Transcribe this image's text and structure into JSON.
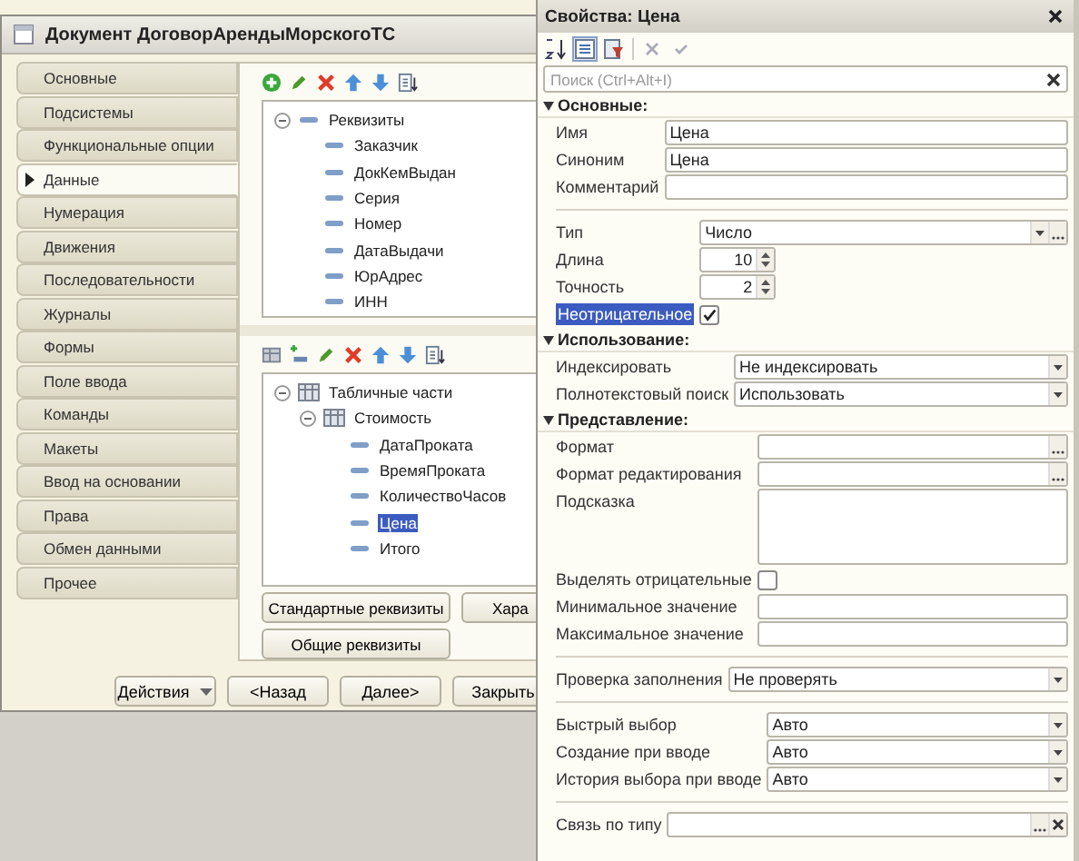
{
  "window": {
    "title": "Документ ДоговорАрендыМорскогоТС"
  },
  "nav": [
    {
      "label": "Основные",
      "selected": false
    },
    {
      "label": "Подсистемы",
      "selected": false
    },
    {
      "label": "Функциональные опции",
      "selected": false
    },
    {
      "label": "Данные",
      "selected": true
    },
    {
      "label": "Нумерация",
      "selected": false
    },
    {
      "label": "Движения",
      "selected": false
    },
    {
      "label": "Последовательности",
      "selected": false
    },
    {
      "label": "Журналы",
      "selected": false
    },
    {
      "label": "Формы",
      "selected": false
    },
    {
      "label": "Поле ввода",
      "selected": false
    },
    {
      "label": "Команды",
      "selected": false
    },
    {
      "label": "Макеты",
      "selected": false
    },
    {
      "label": "Ввод на основании",
      "selected": false
    },
    {
      "label": "Права",
      "selected": false
    },
    {
      "label": "Обмен данными",
      "selected": false
    },
    {
      "label": "Прочее",
      "selected": false
    }
  ],
  "attributes_tree": [
    {
      "label": "Реквизиты",
      "kind": "group",
      "expanded": true,
      "selected": false,
      "children": [
        {
          "label": "Заказчик",
          "kind": "attribute",
          "selected": false
        },
        {
          "label": "ДокКемВыдан",
          "kind": "attribute",
          "selected": false
        },
        {
          "label": "Серия",
          "kind": "attribute",
          "selected": false
        },
        {
          "label": "Номер",
          "kind": "attribute",
          "selected": false
        },
        {
          "label": "ДатаВыдачи",
          "kind": "attribute",
          "selected": false
        },
        {
          "label": "ЮрАдрес",
          "kind": "attribute",
          "selected": false
        },
        {
          "label": "ИНН",
          "kind": "attribute",
          "selected": false
        }
      ]
    }
  ],
  "tables_tree": [
    {
      "label": "Табличные части",
      "kind": "table",
      "expanded": true,
      "selected": false,
      "children": [
        {
          "label": "Стоимость",
          "kind": "table",
          "expanded": true,
          "selected": false,
          "children": [
            {
              "label": "ДатаПроката",
              "kind": "attribute",
              "selected": false
            },
            {
              "label": "ВремяПроката",
              "kind": "attribute",
              "selected": false
            },
            {
              "label": "КоличествоЧасов",
              "kind": "attribute",
              "selected": false
            },
            {
              "label": "Цена",
              "kind": "attribute",
              "selected": true
            },
            {
              "label": "Итого",
              "kind": "attribute",
              "selected": false
            }
          ]
        }
      ]
    }
  ],
  "pane_buttons": [
    [
      "Стандартные реквизиты",
      "Хара"
    ],
    [
      "Общие реквизиты"
    ]
  ],
  "footer_buttons": [
    {
      "label": "Действия",
      "kind": "menu"
    },
    {
      "label": "<Назад",
      "kind": "plain"
    },
    {
      "label": "Далее>",
      "kind": "plain"
    },
    {
      "label": "Закрыть",
      "kind": "plain"
    }
  ],
  "properties": {
    "title": "Свойства: Цена",
    "search": {
      "placeholder": "Поиск (Ctrl+Alt+I)"
    },
    "sections": [
      {
        "title": "Основные:",
        "expanded": true,
        "blocks": [
          [
            {
              "kind": "text",
              "label": "Имя",
              "value": "Цена",
              "selected": false
            },
            {
              "kind": "text",
              "label": "Синоним",
              "value": "Цена",
              "selected": false
            },
            {
              "kind": "text",
              "label": "Комментарий",
              "selected": false
            }
          ],
          [
            {
              "kind": "select_choice",
              "label": "Тип",
              "value": "Число",
              "selected": false
            },
            {
              "kind": "spin",
              "label": "Длина",
              "value": "10",
              "selected": false
            },
            {
              "kind": "spin",
              "label": "Точность",
              "value": "2",
              "selected": false
            },
            {
              "kind": "checkbox",
              "label": "Неотрицательное",
              "checked": true,
              "selected": true
            }
          ]
        ]
      },
      {
        "title": "Использование:",
        "expanded": true,
        "blocks": [
          [
            {
              "kind": "select",
              "label": "Индексировать",
              "value": "Не индексировать",
              "selected": false
            },
            {
              "kind": "select",
              "label": "Полнотекстовый поиск",
              "value": "Использовать",
              "selected": false
            }
          ]
        ]
      },
      {
        "title": "Представление:",
        "expanded": true,
        "blocks": [
          [
            {
              "kind": "choice",
              "label": "Формат",
              "selected": false
            },
            {
              "kind": "choice",
              "label": "Формат редактирования",
              "selected": false
            },
            {
              "kind": "textarea",
              "label": "Подсказка",
              "selected": false
            },
            {
              "kind": "checkbox",
              "label": "Выделять отрицательные",
              "checked": false,
              "selected": false
            },
            {
              "kind": "text",
              "label": "Минимальное значение",
              "selected": false
            },
            {
              "kind": "text",
              "label": "Максимальное значение",
              "selected": false
            }
          ],
          [
            {
              "kind": "select",
              "label": "Проверка заполнения",
              "value": "Не проверять",
              "selected": false
            }
          ],
          [
            {
              "kind": "select",
              "label": "Быстрый выбор",
              "value": "Авто",
              "selected": false
            },
            {
              "kind": "select",
              "label": "Создание при вводе",
              "value": "Авто",
              "selected": false
            },
            {
              "kind": "select",
              "label": "История выбора при вводе",
              "value": "Авто",
              "selected": false
            }
          ],
          [
            {
              "kind": "choice_clear",
              "label": "Связь по типу",
              "selected": false
            }
          ]
        ]
      }
    ]
  }
}
